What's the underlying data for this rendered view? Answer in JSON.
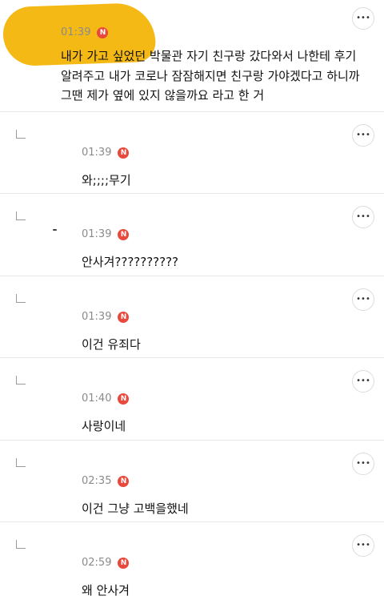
{
  "post": {
    "time": "01:39",
    "badge": "N",
    "text_lines": [
      "내가 가고 싶었던 박물관 자기 친구랑 갔다와서 나한테 후기",
      "알려주고 내가 코로나 잠잠해지면 친구랑 가야겠다고 하니까",
      "그땐 제가 옆에 있지 않을까요 라고 한 거"
    ],
    "menu_label": "•••"
  },
  "replies": [
    {
      "time": "01:39",
      "badge": "N",
      "text": "와;;;;무기",
      "menu_label": "•••"
    },
    {
      "time": "01:39",
      "badge": "N",
      "text": "안사겨??????????",
      "menu_label": "•••"
    },
    {
      "time": "01:39",
      "badge": "N",
      "text": "이건 유죄다",
      "menu_label": "•••"
    },
    {
      "time": "01:40",
      "badge": "N",
      "text": "사랑이네",
      "menu_label": "•••"
    },
    {
      "time": "02:35",
      "badge": "N",
      "text": "이건 그냥 고백을했네",
      "menu_label": "•••"
    },
    {
      "time": "02:59",
      "badge": "N",
      "text": "왜 안사겨",
      "menu_label": "•••"
    }
  ],
  "colors": {
    "accent_highlight": "#f5b915",
    "badge": "#e8493c",
    "time": "#8a8a8a"
  }
}
